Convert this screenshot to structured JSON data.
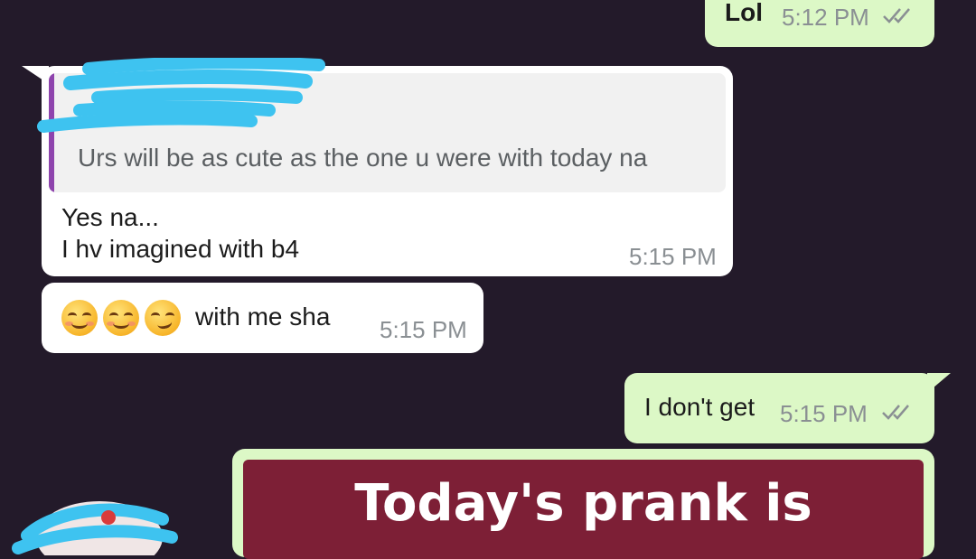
{
  "messages": {
    "lol": {
      "text": "Lol",
      "time": "5:12 PM"
    },
    "quote": {
      "quoted_text": "Urs will be as cute as the one u were with today na",
      "line1": "Yes na...",
      "line2": "I hv imagined with b4",
      "time": "5:15 PM"
    },
    "emoji_msg": {
      "text": "with me sha",
      "time": "5:15 PM"
    },
    "dont_get": {
      "text": "I don't get",
      "time": "5:15 PM"
    },
    "prank": {
      "text": "Today's prank is"
    }
  },
  "colors": {
    "background": "#231a2a",
    "incoming": "#ffffff",
    "outgoing": "#dcf8c6",
    "quote_bar": "#8e44ad",
    "prank_card": "#7d1f36",
    "scribble": "#3ec3f0"
  },
  "icons": [
    "double-check-icon",
    "smiling-face-emoji",
    "smirking-face-emoji",
    "redaction-scribble"
  ]
}
